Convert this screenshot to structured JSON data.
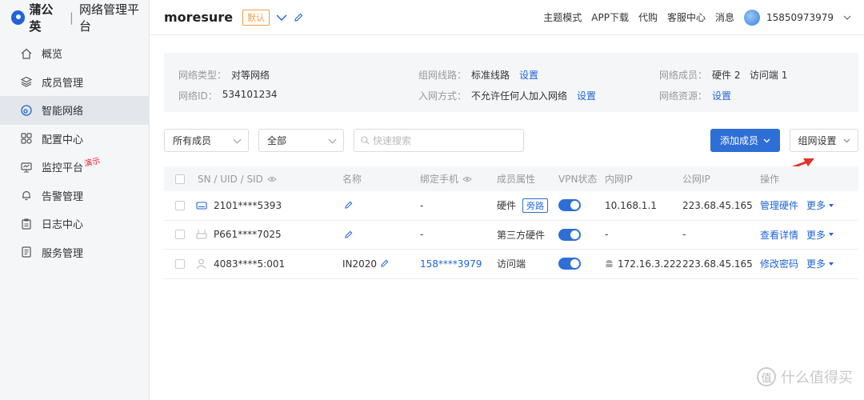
{
  "app": {
    "logo_text": "蒲公英",
    "separator": "|",
    "subtitle": "网络管理平台"
  },
  "sidebar": {
    "items": [
      {
        "label": "概览",
        "icon": "home-icon"
      },
      {
        "label": "成员管理",
        "icon": "layers-icon"
      },
      {
        "label": "智能网络",
        "icon": "network-icon",
        "active": true
      },
      {
        "label": "配置中心",
        "icon": "grid-icon"
      },
      {
        "label": "监控平台",
        "icon": "monitor-icon",
        "badge": "演示"
      },
      {
        "label": "告警管理",
        "icon": "bell-icon"
      },
      {
        "label": "日志中心",
        "icon": "clipboard-icon"
      },
      {
        "label": "服务管理",
        "icon": "document-icon"
      }
    ]
  },
  "topbar": {
    "network_name": "moresure",
    "default_tag": "默认",
    "links": [
      "主题模式",
      "APP下载",
      "代购",
      "客服中心",
      "消息"
    ],
    "user_phone": "15850973979"
  },
  "info": {
    "network_type_label": "网络类型：",
    "network_type_value": "对等网络",
    "network_id_label": "网络ID：",
    "network_id_value": "534101234",
    "route_label": "组网线路：",
    "route_value": "标准线路",
    "route_link": "设置",
    "join_label": "入网方式：",
    "join_value": "不允许任何人加入网络",
    "join_link": "设置",
    "members_label": "网络成员：",
    "members_value": "硬件 2   访问端 1",
    "resources_label": "网络资源：",
    "resources_link": "设置"
  },
  "filters": {
    "member_select": "所有成员",
    "status_select": "全部",
    "search_placeholder": "快速搜索",
    "add_button": "添加成员",
    "network_settings_button": "组网设置"
  },
  "table": {
    "headers": [
      "SN / UID / SID",
      "名称",
      "绑定手机",
      "成员属性",
      "VPN状态",
      "内网IP",
      "公网IP",
      "操作"
    ],
    "rows": [
      {
        "id": "2101****5393",
        "name": "",
        "phone": "-",
        "attr": "硬件",
        "attr_tag": "旁路",
        "vpn": true,
        "lan_ip": "10.168.1.1",
        "wan_ip": "223.68.45.165",
        "action": "管理硬件",
        "more": "更多",
        "device_icon": "router-icon"
      },
      {
        "id": "P661****7025",
        "name": "",
        "phone": "-",
        "attr": "第三方硬件",
        "attr_tag": "",
        "vpn": true,
        "lan_ip": "-",
        "wan_ip": "-",
        "action": "查看详情",
        "more": "更多",
        "device_icon": "device-icon"
      },
      {
        "id": "4083****5:001",
        "name": "IN2020",
        "phone": "158****3979",
        "attr": "访问端",
        "attr_tag": "",
        "vpn": true,
        "lan_ip": "172.16.3.222",
        "wan_ip": "223.68.45.165",
        "action": "修改密码",
        "more": "更多",
        "device_icon": "user-icon"
      }
    ]
  },
  "watermark": {
    "text": "什么值得买",
    "icon_text": "值"
  },
  "colors": {
    "primary": "#2e6fd6",
    "accent_tag": "#f0a040",
    "annotation": "#e8302a"
  }
}
